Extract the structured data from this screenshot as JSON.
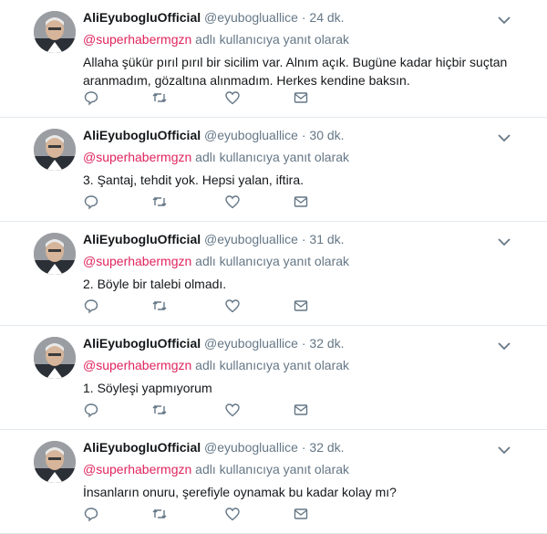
{
  "colors": {
    "mention": "#e0245e",
    "meta": "#657786",
    "divider": "#e1e8ed"
  },
  "icons": [
    "reply-icon",
    "retweet-icon",
    "like-icon",
    "direct-message-icon",
    "chevron-down-icon"
  ],
  "tweets": [
    {
      "name": "AliEyubogluOfficial",
      "handle": "@eyubogluallice",
      "sep": "·",
      "time": "24 dk.",
      "mention": "@superhabermgzn",
      "reply_suffix": " adlı kullanıcıya yanıt olarak",
      "text": "Allaha şükür pırıl pırıl bir sicilim var. Alnım açık. Bugüne kadar hiçbir suçtan aranmadım, gözaltına alınmadım. Herkes kendine baksın."
    },
    {
      "name": "AliEyubogluOfficial",
      "handle": "@eyubogluallice",
      "sep": "·",
      "time": "30 dk.",
      "mention": "@superhabermgzn",
      "reply_suffix": " adlı kullanıcıya yanıt olarak",
      "text": "3. Şantaj, tehdit yok. Hepsi yalan, iftira."
    },
    {
      "name": "AliEyubogluOfficial",
      "handle": "@eyubogluallice",
      "sep": "·",
      "time": "31 dk.",
      "mention": "@superhabermgzn",
      "reply_suffix": " adlı kullanıcıya yanıt olarak",
      "text": "2. Böyle bir talebi olmadı."
    },
    {
      "name": "AliEyubogluOfficial",
      "handle": "@eyubogluallice",
      "sep": "·",
      "time": "32 dk.",
      "mention": "@superhabermgzn",
      "reply_suffix": " adlı kullanıcıya yanıt olarak",
      "text": "1. Söyleşi yapmıyorum"
    },
    {
      "name": "AliEyubogluOfficial",
      "handle": "@eyubogluallice",
      "sep": "·",
      "time": "32 dk.",
      "mention": "@superhabermgzn",
      "reply_suffix": " adlı kullanıcıya yanıt olarak",
      "text": "İnsanların onuru, şerefiyle oynamak bu kadar kolay mı?"
    }
  ]
}
